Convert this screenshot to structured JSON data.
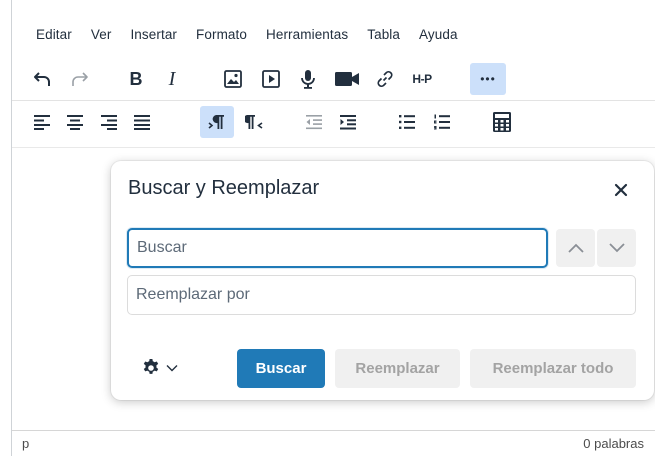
{
  "menubar": {
    "items": [
      "Editar",
      "Ver",
      "Insertar",
      "Formato",
      "Herramientas",
      "Tabla",
      "Ayuda"
    ]
  },
  "toolbar": {
    "bold_label": "B",
    "italic_label": "I",
    "h5p_label": "H-P",
    "more_label": "•••",
    "row1_icons": [
      "undo-icon",
      "redo-icon",
      "bold-icon",
      "italic-icon",
      "image-icon",
      "media-icon",
      "microphone-icon",
      "video-camera-icon",
      "link-icon",
      "h5p-icon",
      "more-icon"
    ],
    "row2_icons": [
      "align-left-icon",
      "align-center-icon",
      "align-right-icon",
      "align-justify-icon",
      "ltr-icon",
      "rtl-icon",
      "outdent-icon",
      "indent-icon",
      "bullet-list-icon",
      "numbered-list-icon",
      "calculator-icon"
    ]
  },
  "dialog": {
    "title": "Buscar y Reemplazar",
    "find_placeholder": "Buscar",
    "replace_placeholder": "Reemplazar por",
    "find_button": "Buscar",
    "replace_button": "Reemplazar",
    "replace_all_button": "Reemplazar todo"
  },
  "statusbar": {
    "path": "p",
    "wordcount": "0 palabras"
  },
  "colors": {
    "primary": "#207ab7",
    "active_button_bg": "#cce0fa",
    "icon": "#222f3e",
    "disabled_text": "#a3a3a3",
    "disabled_bg": "#f0f0f0"
  }
}
